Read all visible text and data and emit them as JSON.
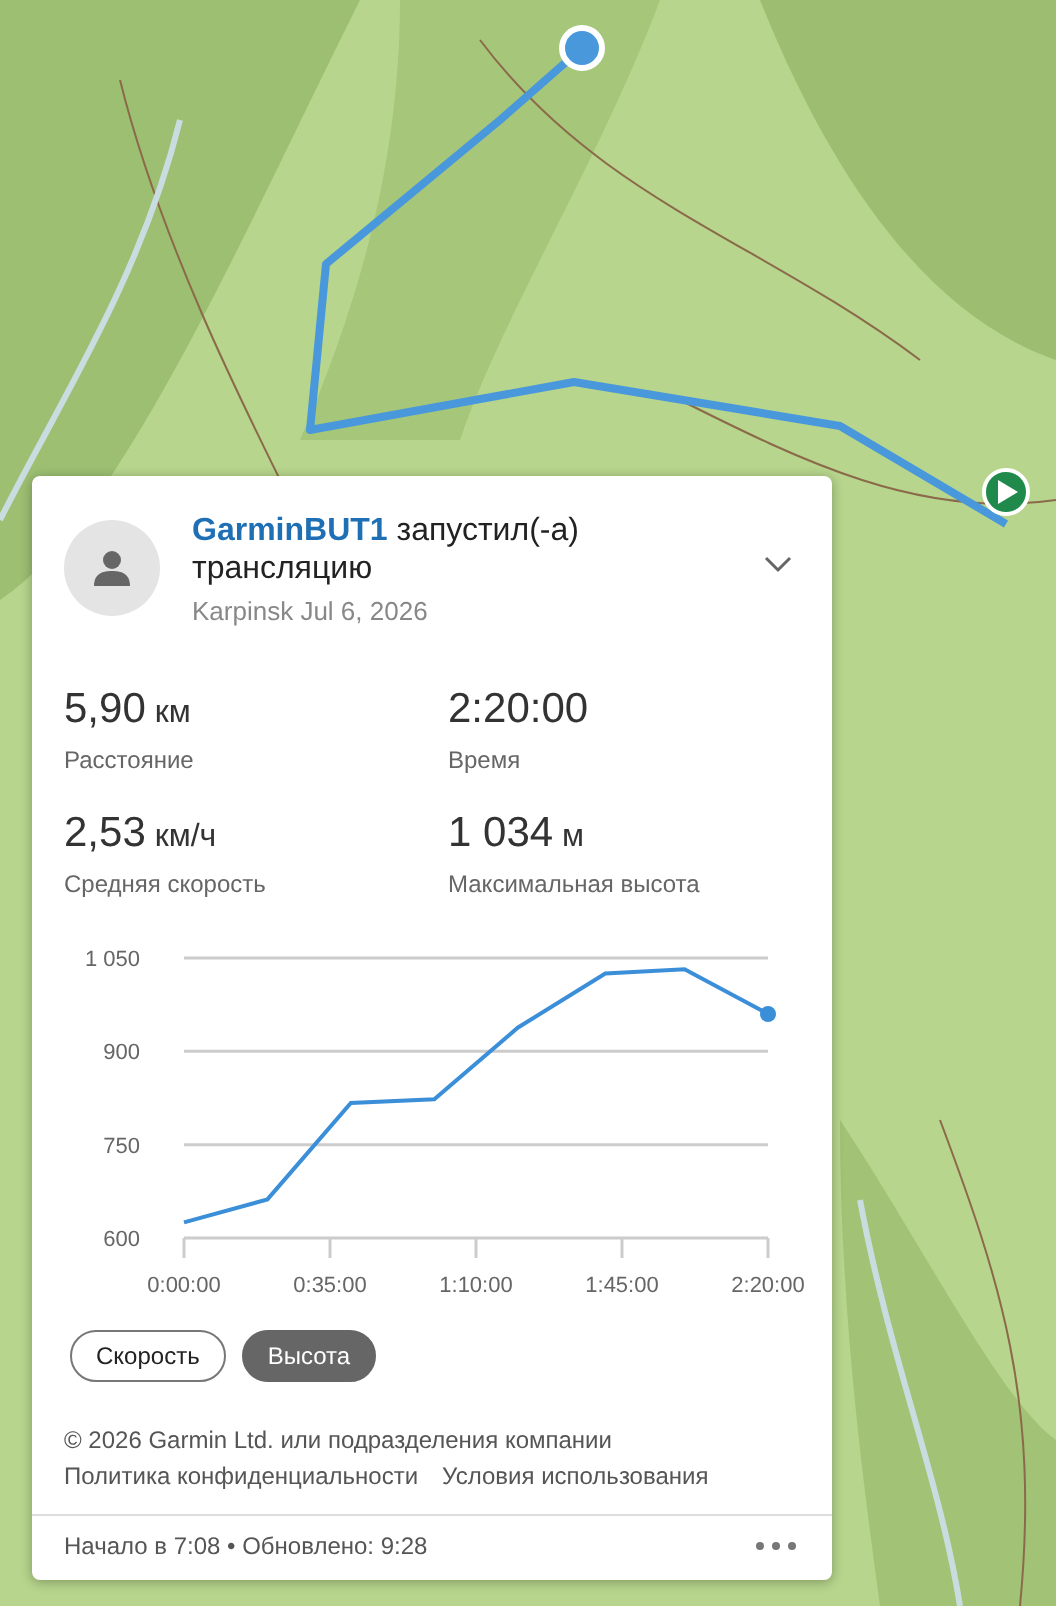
{
  "event": {
    "user": "GarminBUT1",
    "action": "запустил(-а) трансляцию",
    "meta": "Karpinsk Jul 6, 2026"
  },
  "stats": [
    {
      "value": "5,90",
      "unit": "км",
      "label": "Расстояние"
    },
    {
      "value": "2:20:00",
      "label": "Время"
    },
    {
      "value": "2,53",
      "unit": "км/ч",
      "label": "Средняя скорость"
    },
    {
      "value": "1 034",
      "unit": "м",
      "label": "Максимальная высота"
    }
  ],
  "chart": {
    "chart_data": {
      "type": "line",
      "x": [
        0,
        20,
        40,
        60,
        80,
        101,
        120,
        140
      ],
      "series": [
        {
          "color": "#3b8fd9",
          "values": [
            625,
            662,
            817,
            823,
            938,
            1025,
            1032,
            960
          ]
        }
      ],
      "xlim": [
        0,
        140
      ],
      "ylim": [
        600,
        1050
      ],
      "xticks": [
        {
          "value": 0,
          "label": "0:00:00"
        },
        {
          "value": 35,
          "label": "0:35:00"
        },
        {
          "value": 70,
          "label": "1:10:00"
        },
        {
          "value": 105,
          "label": "1:45:00"
        },
        {
          "value": 140,
          "label": "2:20:00"
        }
      ],
      "yticks": [
        600,
        750,
        900,
        {
          "value": 1050,
          "label": "1 050"
        }
      ]
    }
  },
  "toggles": [
    {
      "label": "Скорость",
      "selected": false
    },
    {
      "label": "Высота",
      "selected": true
    }
  ],
  "legal": {
    "copyright": "© 2026 Garmin Ltd. или подразделения компании",
    "links": [
      "Политика конфиденциальности",
      "Условия использования"
    ]
  },
  "footer": {
    "status": "Начало в 7:08 • Обновлено: 9:28"
  }
}
